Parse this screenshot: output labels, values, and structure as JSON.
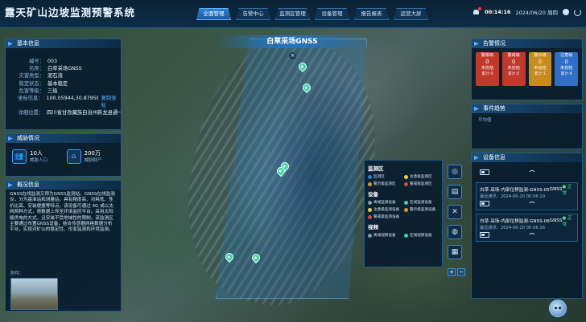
{
  "header": {
    "title": "露天矿山边坡监测预警系统",
    "nav": [
      "全面管理",
      "告警中心",
      "监测区管理",
      "设备管理",
      "报告报表",
      "运营大屏"
    ],
    "time": "00:14:16",
    "date": "2024/06/20 周四"
  },
  "basic": {
    "title": "基本信息",
    "rows": [
      {
        "k": "编号：",
        "v": "003"
      },
      {
        "k": "名称：",
        "v": "白草采场GNSS"
      },
      {
        "k": "灾害类型：",
        "v": "泥石流"
      },
      {
        "k": "稳定状态：",
        "v": "基本稳定"
      },
      {
        "k": "危害等级：",
        "v": "三级"
      },
      {
        "k": "坐标信息：",
        "v": "100.05944,30.87958"
      },
      {
        "k": "详细位置：",
        "v": "四川省甘孜藏族自治州新龙县通一..."
      }
    ],
    "locate": "复制坐标"
  },
  "threat": {
    "title": "威胁情况",
    "items": [
      {
        "value": "10人",
        "label": "威胁人口",
        "icon": "people-icon"
      },
      {
        "value": "200万",
        "label": "威胁财产",
        "icon": "house-icon"
      }
    ]
  },
  "overview": {
    "title": "概况信息",
    "text": "GNSS在线监测又称为GNSS监测站。GNSS在线监测仪，分为基准站和测量站。具有精度高、功耗低、性价比高、安装便捷等特点。该设备可通过 4G 或以太网两种方式，将数据上传至环境监控平台。采用太阳能供电的方式，且安装不受地域性的限制。该监测区主要通过布置GNSS设备，结合传感器网格数据分析平台，实现对矿山的稳定性、形变监测和环境监测。",
    "attach": "附件："
  },
  "map": {
    "zone_title": "白草采场GNSS",
    "close": "×",
    "legend": {
      "zone_head": "监测区",
      "zones": [
        {
          "label": "监测区",
          "color": "#2f7fe0"
        },
        {
          "label": "注意级监测区",
          "color": "#e6d23a"
        },
        {
          "label": "警示级监测区",
          "color": "#e8922e"
        },
        {
          "label": "警戒级监测区",
          "color": "#e04646"
        }
      ],
      "device_head": "设备",
      "devices": [
        {
          "label": "离线监测设备",
          "color": "#8a9aa8"
        },
        {
          "label": "在线监测设备",
          "color": "#38d6a8"
        },
        {
          "label": "注意级监测设备",
          "color": "#e6d23a"
        },
        {
          "label": "警示级监测设备",
          "color": "#e8922e"
        },
        {
          "label": "警戒级监测设备",
          "color": "#e04646"
        }
      ],
      "video_head": "视频",
      "videos": [
        {
          "label": "离线视频设备",
          "color": "#8a9aa8"
        },
        {
          "label": "在线视频设备",
          "color": "#38d6a8"
        }
      ]
    },
    "tools": [
      "target-icon",
      "map-icon",
      "satellite-icon",
      "globe-icon",
      "layers-icon"
    ],
    "zoom": [
      "+",
      "−"
    ]
  },
  "alarm": {
    "title": "告警情况",
    "cards": [
      {
        "level": "警报级",
        "count": "0",
        "status": "未完结",
        "total": "累计:0",
        "color": "#c0392b"
      },
      {
        "level": "警戒级",
        "count": "0",
        "status": "未完结",
        "total": "累计:0",
        "color": "#c0392b"
      },
      {
        "level": "警示级",
        "count": "0",
        "status": "未完结",
        "total": "累计:1",
        "color": "#c98a1e"
      },
      {
        "level": "注意级",
        "count": "0",
        "status": "未完结",
        "total": "累计:4",
        "color": "#2f6fc7"
      }
    ]
  },
  "trend": {
    "title": "事件趋势",
    "label": "平均值"
  },
  "devices": {
    "title": "设备信息",
    "list": [
      {
        "name": "白草-采场-内部位移监测-GNSS-05",
        "type": "GNSS",
        "status": "● 正常",
        "time": "最近通讯：2024-06-20 00:06:19"
      },
      {
        "name": "白草-采场-内部位移监测-GNSS-06",
        "type": "GNSS",
        "status": "● 正常",
        "time": "最近通讯：2024-06-20 00:06:16"
      }
    ]
  }
}
